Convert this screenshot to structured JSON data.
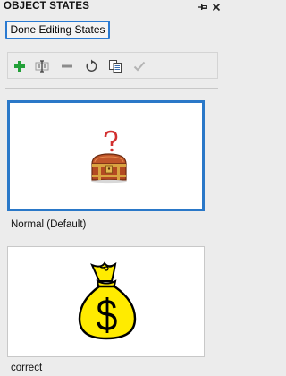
{
  "panel": {
    "title": "OBJECT STATES"
  },
  "done_button": {
    "label": "Done Editing States"
  },
  "toolbar": {
    "tools": [
      {
        "icon": "add-state-icon",
        "enabled": true
      },
      {
        "icon": "edit-state-icon",
        "enabled": true
      },
      {
        "icon": "remove-state-icon",
        "enabled": false
      },
      {
        "icon": "reset-state-icon",
        "enabled": true
      },
      {
        "icon": "duplicate-state-icon",
        "enabled": true
      },
      {
        "icon": "confirm-state-icon",
        "enabled": false
      }
    ]
  },
  "states": [
    {
      "label": "Normal (Default)",
      "selected": true,
      "thumbnail": "treasure-chest-question-icon"
    },
    {
      "label": "correct",
      "selected": false,
      "thumbnail": "money-bag-dollar-icon"
    }
  ],
  "colors": {
    "accent": "#2a7ad1",
    "add_green": "#22a038",
    "panel_bg": "#ececec"
  }
}
